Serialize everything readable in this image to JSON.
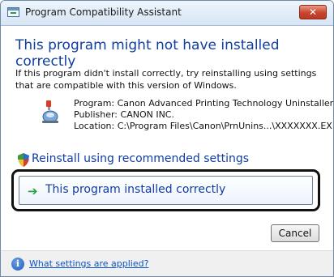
{
  "window": {
    "title": "Program Compatibility Assistant",
    "close_label": "✕"
  },
  "heading": "This program might not have installed correctly",
  "description": "If this program didn't install correctly, try reinstalling using settings that are compatible with this version of Windows.",
  "program": {
    "name_line": "Program: Canon Advanced Printing Technology Uninstaller",
    "publisher_line": "Publisher: CANON INC.",
    "location_line": "Location: C:\\Program Files\\Canon\\PrnUnins...\\XXXXXXX.EXE"
  },
  "options": {
    "reinstall_label": "Reinstall using recommended settings",
    "installed_label": "This program installed correctly"
  },
  "buttons": {
    "cancel_label": "Cancel"
  },
  "footer": {
    "link_label": "What settings are applied?"
  },
  "colors": {
    "heading": "#0f3da0",
    "link": "#0b55c7",
    "arrow": "#25a244"
  }
}
